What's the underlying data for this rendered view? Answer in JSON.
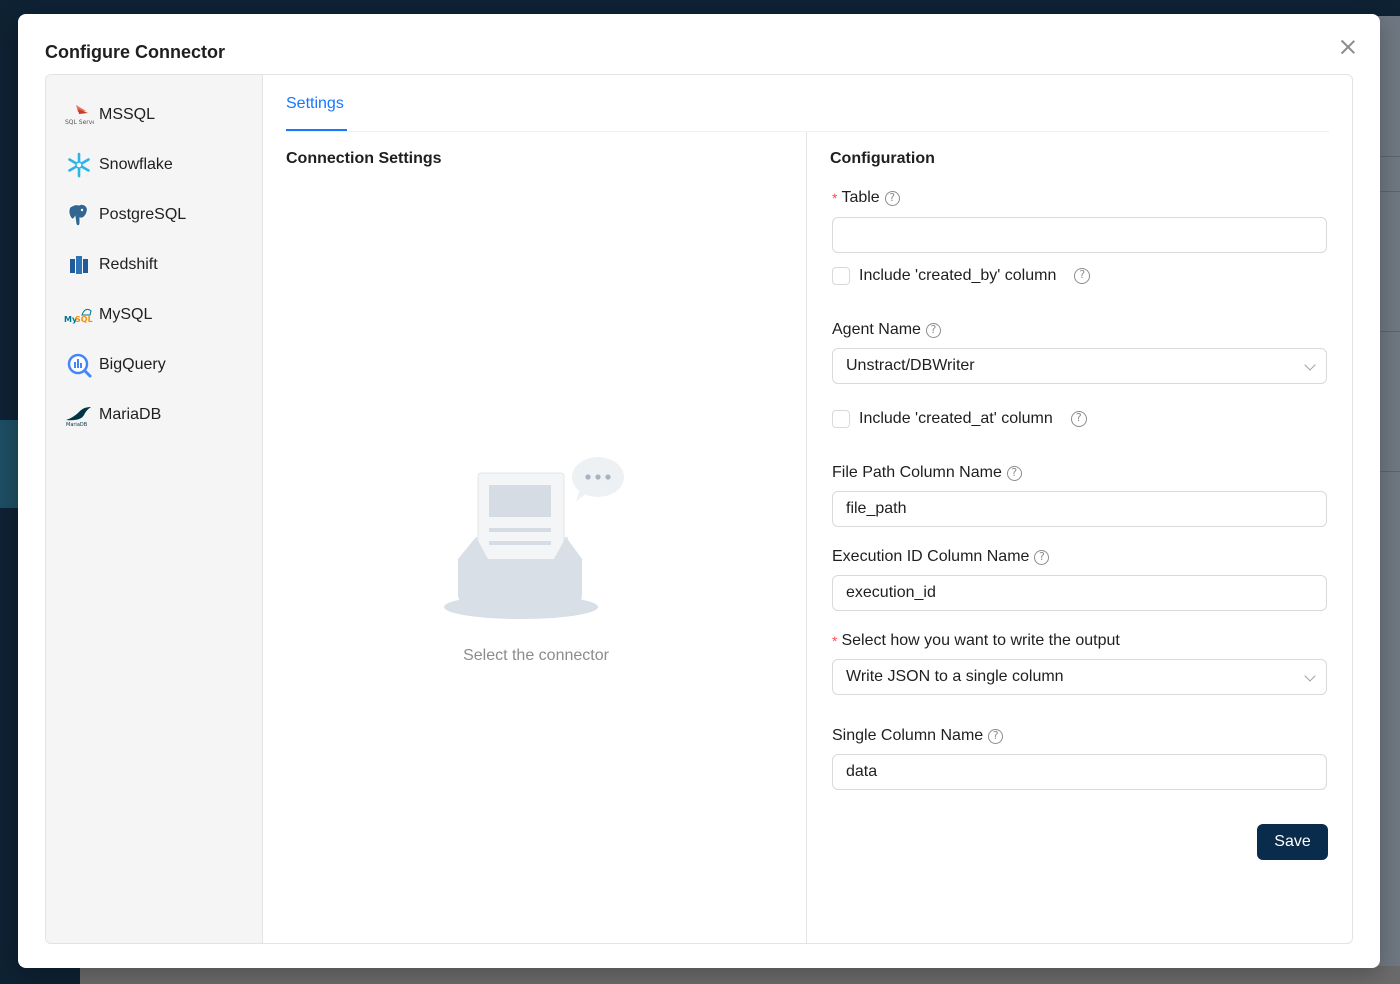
{
  "modal": {
    "title": "Configure Connector"
  },
  "connectors": [
    {
      "label": "MSSQL",
      "icon": "mssql-icon"
    },
    {
      "label": "Snowflake",
      "icon": "snowflake-icon"
    },
    {
      "label": "PostgreSQL",
      "icon": "postgresql-icon"
    },
    {
      "label": "Redshift",
      "icon": "redshift-icon"
    },
    {
      "label": "MySQL",
      "icon": "mysql-icon"
    },
    {
      "label": "BigQuery",
      "icon": "bigquery-icon"
    },
    {
      "label": "MariaDB",
      "icon": "mariadb-icon"
    }
  ],
  "tabs": [
    {
      "label": "Settings",
      "active": true
    }
  ],
  "connection_settings": {
    "title": "Connection Settings",
    "empty_caption": "Select the connector"
  },
  "configuration": {
    "title": "Configuration",
    "table": {
      "label": "Table",
      "required": true,
      "value": ""
    },
    "include_created_by": {
      "label": "Include 'created_by' column",
      "checked": false
    },
    "agent_name": {
      "label": "Agent Name",
      "value": "Unstract/DBWriter"
    },
    "include_created_at": {
      "label": "Include 'created_at' column",
      "checked": false
    },
    "file_path_column": {
      "label": "File Path Column Name",
      "value": "file_path"
    },
    "execution_id_column": {
      "label": "Execution ID Column Name",
      "value": "execution_id"
    },
    "write_output": {
      "label": "Select how you want to write the output",
      "required": true,
      "value": "Write JSON to a single column"
    },
    "single_column_name": {
      "label": "Single Column Name",
      "value": "data"
    },
    "save_label": "Save"
  },
  "colors": {
    "accent": "#1677ff",
    "primary_button": "#092c4c",
    "required": "#ff4d4f"
  }
}
